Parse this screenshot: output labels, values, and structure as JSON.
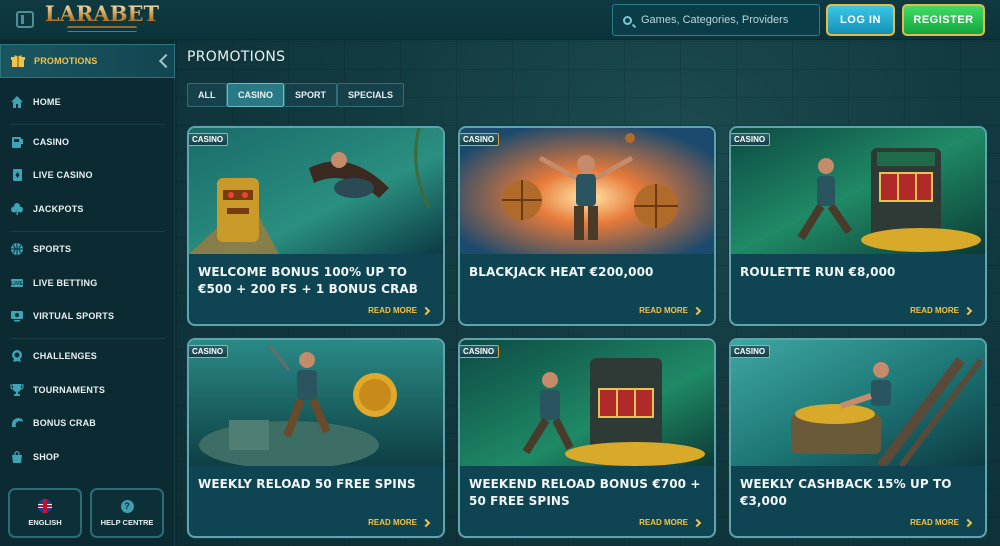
{
  "header": {
    "logo_text": "LARABET",
    "search_placeholder": "Games, Categories, Providers",
    "login_label": "LOG IN",
    "register_label": "REGISTER"
  },
  "sidebar": {
    "items": [
      {
        "label": "PROMOTIONS",
        "icon": "gift-icon",
        "active": true
      },
      {
        "label": "HOME",
        "icon": "home-icon"
      },
      {
        "label": "CASINO",
        "icon": "casino-icon"
      },
      {
        "label": "LIVE CASINO",
        "icon": "cards-icon"
      },
      {
        "label": "JACKPOTS",
        "icon": "clover-icon"
      },
      {
        "label": "SPORTS",
        "icon": "ball-icon"
      },
      {
        "label": "LIVE BETTING",
        "icon": "live-icon"
      },
      {
        "label": "VIRTUAL SPORTS",
        "icon": "monitor-icon"
      },
      {
        "label": "CHALLENGES",
        "icon": "medal-icon"
      },
      {
        "label": "TOURNAMENTS",
        "icon": "trophy-icon"
      },
      {
        "label": "BONUS CRAB",
        "icon": "crab-icon"
      },
      {
        "label": "SHOP",
        "icon": "shop-bag-icon"
      }
    ],
    "language_label": "ENGLISH",
    "help_label": "HELP CENTRE"
  },
  "main": {
    "title": "PROMOTIONS",
    "filters": [
      {
        "label": "ALL",
        "active": false
      },
      {
        "label": "CASINO",
        "active": true
      },
      {
        "label": "SPORT",
        "active": false
      },
      {
        "label": "SPECIALS",
        "active": false
      }
    ],
    "read_more_label": "READ MORE",
    "cards": [
      {
        "badge": "CASINO",
        "title": "WELCOME BONUS 100% UP TO €500 + 200 FS + 1 BONUS CRAB"
      },
      {
        "badge": "CASINO",
        "title": "BLACKJACK HEAT €200,000"
      },
      {
        "badge": "CASINO",
        "title": "ROULETTE RUN €8,000"
      },
      {
        "badge": "CASINO",
        "title": "WEEKLY RELOAD 50 FREE SPINS"
      },
      {
        "badge": "CASINO",
        "title": "WEEKEND RELOAD BONUS €700 + 50 FREE SPINS"
      },
      {
        "badge": "CASINO",
        "title": "WEEKLY CASHBACK 15% UP TO €3,000"
      }
    ]
  },
  "colors": {
    "accent_gold": "#f2c34a",
    "login_blue": "#1ea9cf",
    "register_green": "#22bf4b",
    "background": "#0d2e35"
  }
}
